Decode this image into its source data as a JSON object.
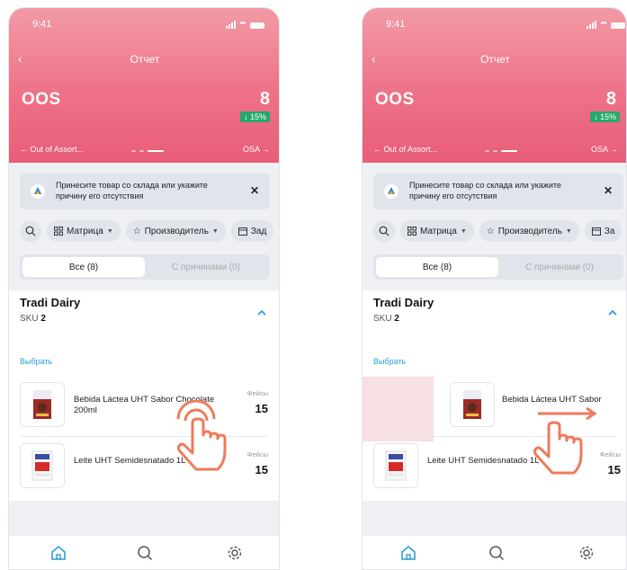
{
  "screens": [
    {
      "status": {
        "time": "9:41"
      },
      "nav": {
        "back": "‹",
        "title": "Отчет"
      },
      "metric": {
        "name": "OOS",
        "value": "8",
        "delta": "↓ 15%"
      },
      "pager": {
        "prev": "← Out of Assort...",
        "next": "OSA →"
      },
      "banner": {
        "text": "Принесите товар со склада или укажите причину его отсутствия",
        "close": "✕"
      },
      "filters": [
        {
          "label": "Матрица"
        },
        {
          "label": "Производитель"
        },
        {
          "label": "Зад"
        }
      ],
      "tabs": [
        {
          "label": "Все (8)"
        },
        {
          "label": "С причинами (0)"
        }
      ],
      "group": {
        "name": "Tradi Dairy",
        "sku_label": "SKU",
        "sku_count": "2",
        "select": "Выбрать"
      },
      "products": [
        {
          "name": "Bebida Láctea UHT Sabor Chocolate 200ml",
          "facings_label": "Фейсы",
          "facings": "15"
        },
        {
          "name": "Leite UHT Semidesnatado 1L",
          "facings_label": "Фейсы",
          "facings": "15"
        }
      ]
    },
    {
      "status": {
        "time": "9:41"
      },
      "nav": {
        "back": "‹",
        "title": "Отчет"
      },
      "metric": {
        "name": "OOS",
        "value": "8",
        "delta": "↓ 15%"
      },
      "pager": {
        "prev": "← Out of Assort...",
        "next": "OSA →"
      },
      "banner": {
        "text": "Принесите товар со склада или укажите причину его отсутствия",
        "close": "✕"
      },
      "filters": [
        {
          "label": "Матрица"
        },
        {
          "label": "Производитель"
        },
        {
          "label": "За"
        }
      ],
      "tabs": [
        {
          "label": "Все (8)"
        },
        {
          "label": "С причинами (0)"
        }
      ],
      "group": {
        "name": "Tradi Dairy",
        "sku_label": "SKU",
        "sku_count": "2",
        "select": "Выбрать"
      },
      "products": [
        {
          "name": "Bebida Láctea UHT Sabor",
          "facings_label": "",
          "facings": ""
        },
        {
          "name": "Leite UHT Semidesnatado 1L",
          "facings_label": "Фейсы",
          "facings": "15"
        }
      ]
    }
  ],
  "colors": {
    "header_top": "#f29aa6",
    "header_bottom": "#e85d77",
    "delta_bg": "#27a86a",
    "link": "#2a9fd8",
    "gesture": "#ef7b5b",
    "swipe_bg": "#f8dfe2"
  },
  "icons": [
    "signal-icon",
    "wifi-icon",
    "battery-icon",
    "back-icon",
    "brand-icon",
    "close-icon",
    "search-icon",
    "grid-icon",
    "star-icon",
    "calendar-icon",
    "chevron-down-icon",
    "chevron-up-icon",
    "home-icon",
    "settings-icon",
    "tap-gesture-icon",
    "swipe-gesture-icon"
  ]
}
